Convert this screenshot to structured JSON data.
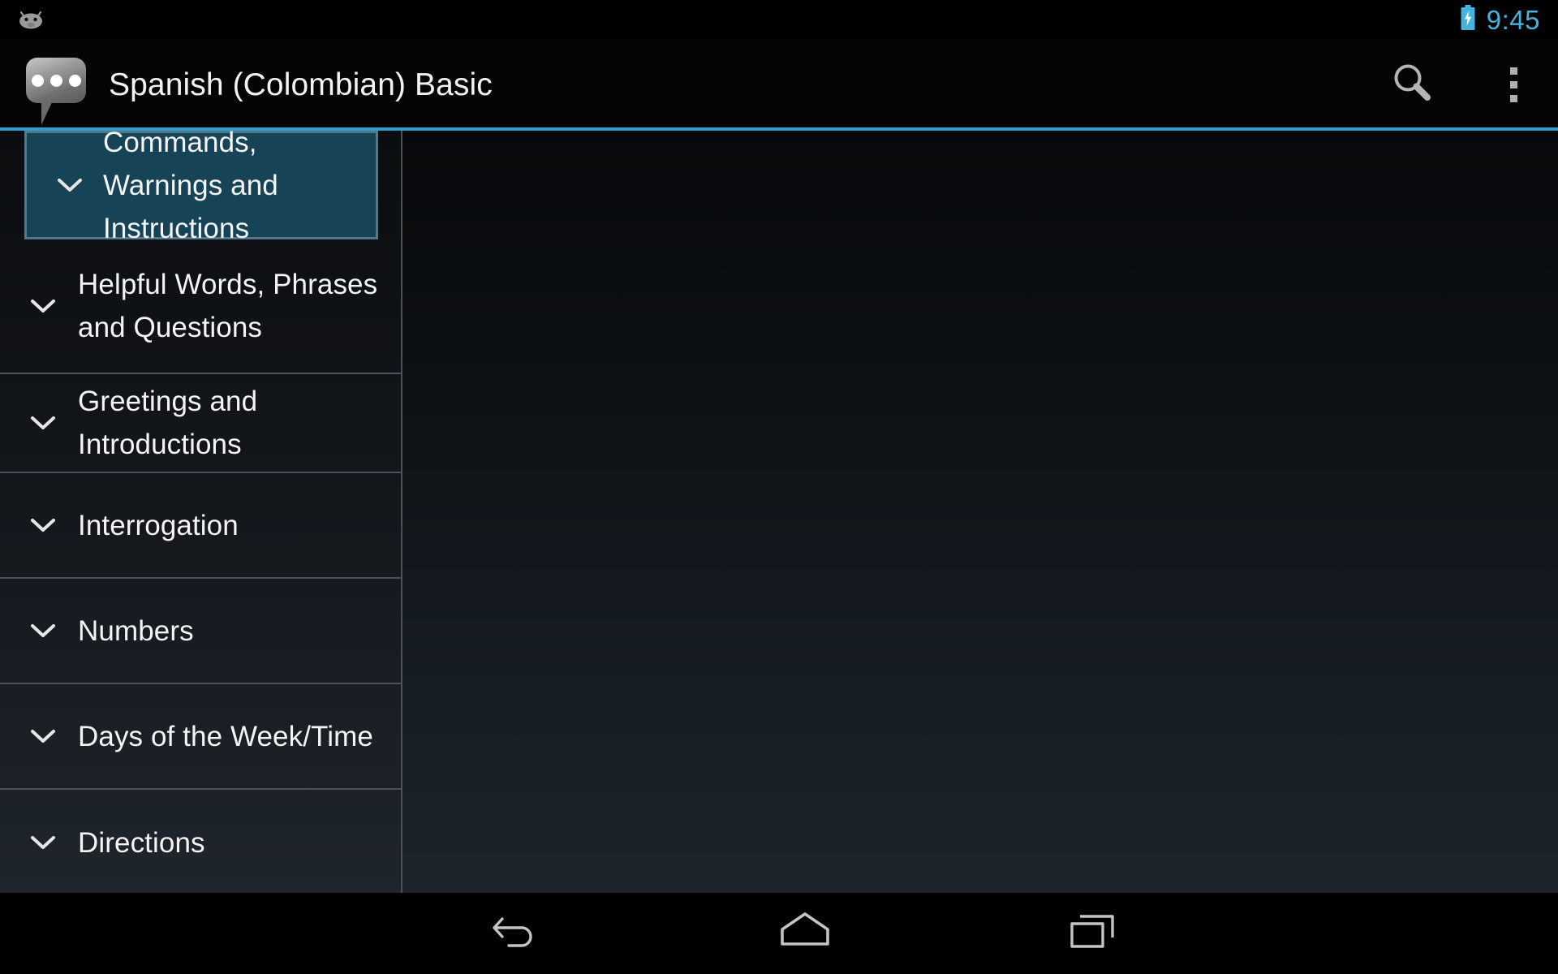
{
  "status_bar": {
    "android_icon": "android-robot-icon",
    "battery_icon": "battery-charging-icon",
    "clock": "9:45",
    "accent_color": "#45b3e0"
  },
  "action_bar": {
    "app_icon": "speech-bubble-icon",
    "title": "Spanish (Colombian) Basic",
    "search_icon": "search-icon",
    "overflow_icon": "overflow-menu-icon",
    "accent_color": "#2b9fc9"
  },
  "sidebar": {
    "selected_index": 0,
    "selected_bg": "#164356",
    "selected_border": "#53788a",
    "items": [
      {
        "label": "Commands, Warnings and Instructions",
        "expander": "chevron-down-icon",
        "selected": true
      },
      {
        "label": "Helpful Words, Phrases and Questions",
        "expander": "chevron-down-icon",
        "selected": false
      },
      {
        "label": "Greetings and Introductions",
        "expander": "chevron-down-icon",
        "selected": false
      },
      {
        "label": "Interrogation",
        "expander": "chevron-down-icon",
        "selected": false
      },
      {
        "label": "Numbers",
        "expander": "chevron-down-icon",
        "selected": false
      },
      {
        "label": "Days of the Week/Time",
        "expander": "chevron-down-icon",
        "selected": false
      },
      {
        "label": "Directions",
        "expander": "chevron-down-icon",
        "selected": false
      }
    ]
  },
  "main_pane": {
    "content": ""
  },
  "nav_bar": {
    "back": "back-arrow-icon",
    "home": "home-icon",
    "recents": "recent-apps-icon"
  }
}
